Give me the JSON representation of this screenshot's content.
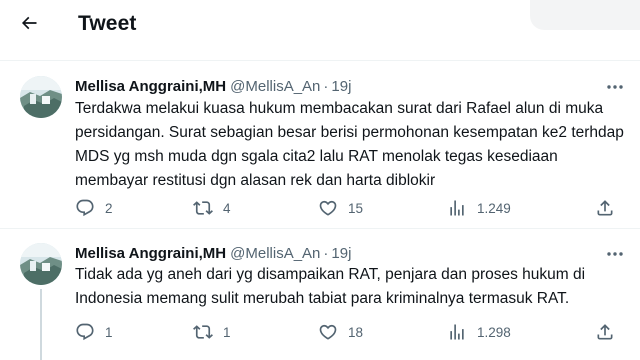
{
  "header": {
    "back_icon": "arrow-left-icon",
    "title": "Tweet"
  },
  "tweets": [
    {
      "author_name": "Mellisa Anggraini,MH",
      "handle": "@MellisA_An",
      "separator": "·",
      "time": "19j",
      "text": "Terdakwa melakui kuasa hukum membacakan surat dari Rafael alun di muka persidangan. Surat sebagian besar berisi permohonan kesempatan ke2 terhdap MDS yg msh muda dgn sgala cita2 lalu RAT menolak tegas kesediaan membayar restitusi dgn alasan rek dan harta diblokir",
      "replies": "2",
      "retweets": "4",
      "likes": "15",
      "views": "1.249"
    },
    {
      "author_name": "Mellisa Anggraini,MH",
      "handle": "@MellisA_An",
      "separator": "·",
      "time": "19j",
      "text": "Tidak ada yg aneh dari yg disampaikan RAT, penjara dan proses hukum di Indonesia memang sulit merubah tabiat para kriminalnya termasuk RAT.",
      "replies": "1",
      "retweets": "1",
      "likes": "18",
      "views": "1.298"
    }
  ],
  "icons": [
    "arrow-left-icon",
    "more-icon",
    "reply-icon",
    "retweet-icon",
    "like-icon",
    "views-icon",
    "share-icon"
  ],
  "colors": {
    "text": "#0f1419",
    "secondary": "#536471",
    "divider": "#eff3f4"
  }
}
